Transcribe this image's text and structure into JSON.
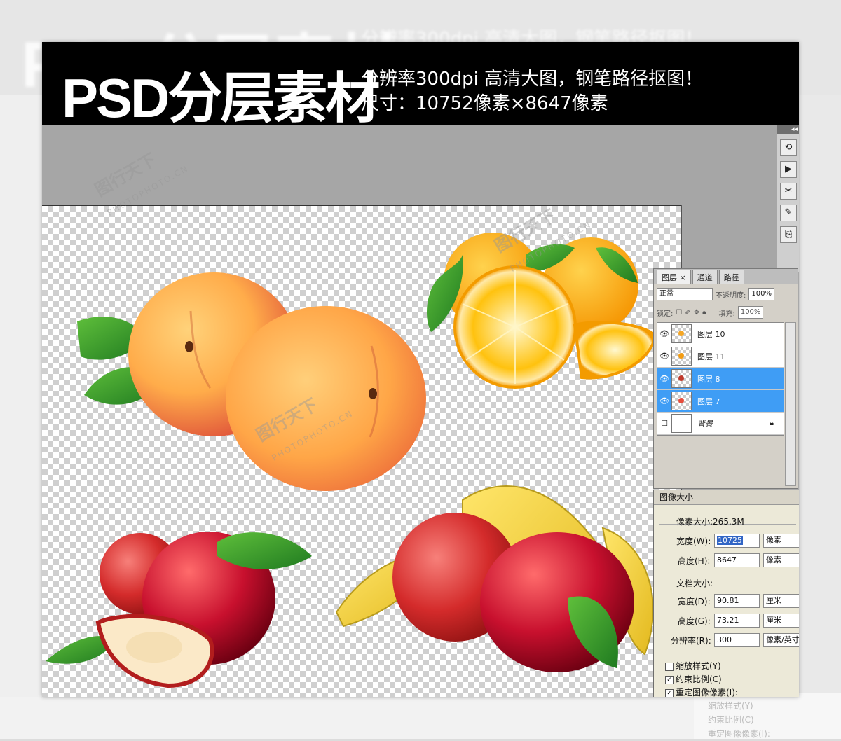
{
  "banner": {
    "title": "PSD分层素材",
    "line1": "分辨率300dpi  高清大图，钢笔路径抠图！",
    "line2": "尺寸：10752像素×8647像素"
  },
  "watermark": {
    "logo_text": "图行天下",
    "site_text": "PHOTOPHOTO.CN"
  },
  "toolstrip": {
    "collapse_label": "◂◂",
    "tools": [
      "history-icon",
      "actions-icon",
      "tool-presets-icon",
      "brushes-icon",
      "clone-source-icon"
    ]
  },
  "layers_panel": {
    "tabs": [
      "图层 ×",
      "通道",
      "路径"
    ],
    "blend_mode": "正常",
    "opacity_label": "不透明度:",
    "opacity_value": "100%",
    "lock_label": "锁定:",
    "fill_label": "填充:",
    "fill_value": "100%",
    "layers": [
      {
        "name": "图层 10",
        "selected": false,
        "visible": true,
        "thumb_color": "#f5a623"
      },
      {
        "name": "图层 11",
        "selected": false,
        "visible": true,
        "thumb_color": "#f39c12"
      },
      {
        "name": "图层 8",
        "selected": true,
        "visible": true,
        "thumb_color": "#c0392b"
      },
      {
        "name": "图层 7",
        "selected": true,
        "visible": true,
        "thumb_color": "#e74c3c"
      },
      {
        "name": "背景",
        "selected": false,
        "visible": false,
        "locked": true
      }
    ]
  },
  "image_size_dialog": {
    "title": "图像大小",
    "pixel_dims_label": "像素大小:265.3M",
    "width_label": "宽度(W):",
    "width_value": "10725",
    "width_unit": "像素",
    "height_label": "高度(H):",
    "height_value": "8647",
    "height_unit": "像素",
    "doc_size_label": "文档大小:",
    "doc_width_label": "宽度(D):",
    "doc_width_value": "90.81",
    "doc_width_unit": "厘米",
    "doc_height_label": "高度(G):",
    "doc_height_value": "73.21",
    "doc_height_unit": "厘米",
    "resolution_label": "分辨率(R):",
    "resolution_value": "300",
    "resolution_unit": "像素/英寸",
    "scale_styles_label": "缩放样式(Y)",
    "scale_styles_checked": false,
    "constrain_label": "约束比例(C)",
    "constrain_checked": true,
    "resample_label": "重定图像像素(I):",
    "resample_checked": true
  },
  "background_ghost": {
    "line1": "缩放样式(Y)",
    "line2": "约束比例(C)",
    "line3": "重定图像像素(I):"
  }
}
